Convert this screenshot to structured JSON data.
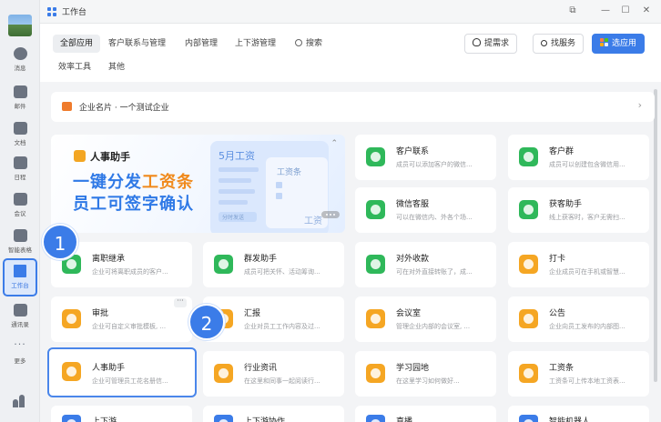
{
  "rail": {
    "items": [
      {
        "label": "消息",
        "icon": "chat-icon"
      },
      {
        "label": "邮件",
        "icon": "mail-icon"
      },
      {
        "label": "文档",
        "icon": "doc-icon"
      },
      {
        "label": "日程",
        "icon": "calendar-icon"
      },
      {
        "label": "会议",
        "icon": "meeting-icon"
      },
      {
        "label": "智能表格",
        "icon": "sheet-icon"
      },
      {
        "label": "工作台",
        "icon": "workbench-icon"
      },
      {
        "label": "通讯录",
        "icon": "contacts-icon"
      },
      {
        "label": "更多",
        "icon": "more-icon"
      }
    ]
  },
  "window": {
    "title": "工作台"
  },
  "tabs": {
    "all": "全部应用",
    "customer": "客户联系与管理",
    "internal": "内部管理",
    "chain": "上下游管理",
    "search": "搜索",
    "efficiency": "效率工具",
    "other": "其他"
  },
  "actions": {
    "request": "提需求",
    "service": "找服务",
    "choose_app": "选应用"
  },
  "company": {
    "text": "企业名片 · 一个测试企业"
  },
  "banner": {
    "title": "人事助手",
    "line1_a": "一键分发",
    "line1_b": "工资条",
    "line2": "员工可签字确认",
    "card_head": "5月工资",
    "card_inner": "工资条",
    "pill": "分时发送",
    "fade": "工资"
  },
  "apps": [
    {
      "name": "客户联系",
      "desc": "成员可以添加客户的微信...",
      "color": "#2fb85a"
    },
    {
      "name": "客户群",
      "desc": "成员可以创建包含微信用...",
      "color": "#2fb85a"
    },
    {
      "name": "微信客服",
      "desc": "可以在微信内、外各个场...",
      "color": "#2fb85a"
    },
    {
      "name": "获客助手",
      "desc": "线上获客时，客户无需扫...",
      "color": "#2fb85a"
    },
    {
      "name": "离职继承",
      "desc": "企业可将离职成员的客户...",
      "color": "#2fb85a"
    },
    {
      "name": "群发助手",
      "desc": "成员可把关怀、活动筹询...",
      "color": "#2fb85a"
    },
    {
      "name": "对外收款",
      "desc": "可在对外直接转账了，成...",
      "color": "#2fb85a"
    },
    {
      "name": "打卡",
      "desc": "企业成员可在手机或智慧...",
      "color": "#f5a623"
    },
    {
      "name": "审批",
      "desc": "企业可自定义审批模板, ...",
      "color": "#f5a623"
    },
    {
      "name": "汇报",
      "desc": "企业对员工工作内容及过...",
      "color": "#f5a623"
    },
    {
      "name": "会议室",
      "desc": "管理企业内部的会议室, ...",
      "color": "#f5a623"
    },
    {
      "name": "公告",
      "desc": "企业向员工发布的内部图...",
      "color": "#f5a623"
    },
    {
      "name": "人事助手",
      "desc": "企业可管理员工花名册信...",
      "color": "#f5a623"
    },
    {
      "name": "行业资讯",
      "desc": "在这里和同事一起阅读行...",
      "color": "#f5a623"
    },
    {
      "name": "学习园地",
      "desc": "在这里学习如何做好...",
      "color": "#f5a623"
    },
    {
      "name": "工资条",
      "desc": "工资条可上传本地工资表...",
      "color": "#f5a623"
    },
    {
      "name": "上下游",
      "desc": "",
      "color": "#3b7ce8"
    },
    {
      "name": "上下游协作",
      "desc": "",
      "color": "#3b7ce8"
    },
    {
      "name": "直播",
      "desc": "",
      "color": "#3b7ce8"
    },
    {
      "name": "智能机器人",
      "desc": "",
      "color": "#3b7ce8"
    }
  ],
  "callouts": [
    "1",
    "2"
  ]
}
